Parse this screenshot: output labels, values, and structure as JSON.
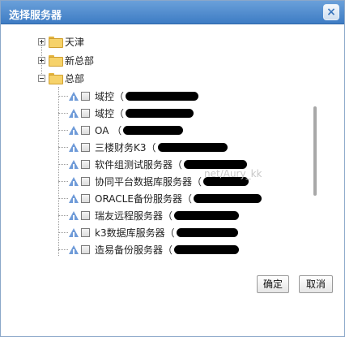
{
  "dialog": {
    "title": "选择服务器",
    "close_label": "×",
    "ok_label": "确定",
    "cancel_label": "取消"
  },
  "tree": {
    "groups": [
      {
        "label": "天津",
        "expanded": false
      },
      {
        "label": "新总部",
        "expanded": false
      },
      {
        "label": "总部",
        "expanded": true
      }
    ],
    "servers": [
      {
        "label": "域控（",
        "checked": false
      },
      {
        "label": "域控（",
        "checked": false
      },
      {
        "label": "OA （",
        "checked": false
      },
      {
        "label": "三楼财务K3（",
        "checked": false
      },
      {
        "label": "软件组测试服务器（",
        "checked": false
      },
      {
        "label": "协同平台数据库服务器（",
        "checked": false
      },
      {
        "label": "ORACLE备份服务器（",
        "checked": false
      },
      {
        "label": "瑞友远程服务器（",
        "checked": false
      },
      {
        "label": "k3数据库服务器（",
        "checked": false
      },
      {
        "label": "造易备份服务器（",
        "checked": false
      }
    ]
  },
  "watermark": "net/Aury_kk",
  "colors": {
    "title_bar_top": "#6aa0da",
    "title_bar_bottom": "#3e7cc4",
    "folder": "#f6d26a",
    "redaction": "#000000"
  },
  "icons": {
    "group": "folder-icon",
    "server": "server-icon",
    "close": "close-icon"
  }
}
